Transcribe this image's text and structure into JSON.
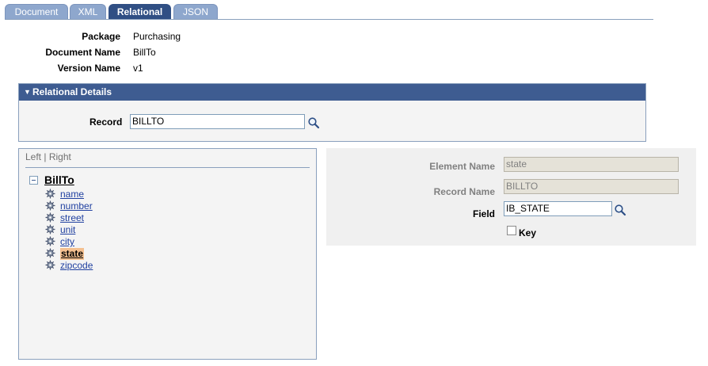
{
  "tabs": [
    {
      "label": "Document",
      "active": false
    },
    {
      "label": "XML",
      "active": false
    },
    {
      "label": "Relational",
      "active": true
    },
    {
      "label": "JSON",
      "active": false
    }
  ],
  "header": {
    "package_label": "Package",
    "package_value": "Purchasing",
    "document_name_label": "Document Name",
    "document_name_value": "BillTo",
    "version_name_label": "Version Name",
    "version_name_value": "v1"
  },
  "relational_details": {
    "title": "Relational Details",
    "record_label": "Record",
    "record_value": "BILLTO"
  },
  "tree": {
    "left_link": "Left",
    "divider": "|",
    "right_link": "Right",
    "root": "BillTo",
    "items": [
      {
        "label": "name",
        "selected": false
      },
      {
        "label": "number",
        "selected": false
      },
      {
        "label": "street",
        "selected": false
      },
      {
        "label": "unit",
        "selected": false
      },
      {
        "label": "city",
        "selected": false
      },
      {
        "label": "state",
        "selected": true
      },
      {
        "label": "zipcode",
        "selected": false
      }
    ]
  },
  "element_detail": {
    "element_name_label": "Element Name",
    "element_name_value": "state",
    "record_name_label": "Record Name",
    "record_name_value": "BILLTO",
    "field_label": "Field",
    "field_value": "IB_STATE",
    "key_label": "Key",
    "key_checked": false
  },
  "colors": {
    "header_bar": "#3e5c91",
    "tab_inactive": "#8ea7cd",
    "tab_active": "#304f84",
    "selected_node": "#f4c090",
    "link": "#2040a0"
  }
}
